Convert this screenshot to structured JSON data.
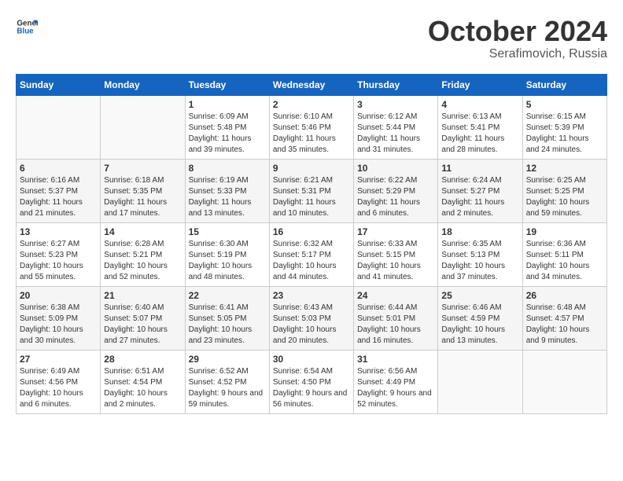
{
  "header": {
    "logo_general": "General",
    "logo_blue": "Blue",
    "title": "October 2024",
    "subtitle": "Serafimovich, Russia"
  },
  "days_of_week": [
    "Sunday",
    "Monday",
    "Tuesday",
    "Wednesday",
    "Thursday",
    "Friday",
    "Saturday"
  ],
  "weeks": [
    [
      {
        "day": "",
        "content": ""
      },
      {
        "day": "",
        "content": ""
      },
      {
        "day": "1",
        "content": "Sunrise: 6:09 AM\nSunset: 5:48 PM\nDaylight: 11 hours and 39 minutes."
      },
      {
        "day": "2",
        "content": "Sunrise: 6:10 AM\nSunset: 5:46 PM\nDaylight: 11 hours and 35 minutes."
      },
      {
        "day": "3",
        "content": "Sunrise: 6:12 AM\nSunset: 5:44 PM\nDaylight: 11 hours and 31 minutes."
      },
      {
        "day": "4",
        "content": "Sunrise: 6:13 AM\nSunset: 5:41 PM\nDaylight: 11 hours and 28 minutes."
      },
      {
        "day": "5",
        "content": "Sunrise: 6:15 AM\nSunset: 5:39 PM\nDaylight: 11 hours and 24 minutes."
      }
    ],
    [
      {
        "day": "6",
        "content": "Sunrise: 6:16 AM\nSunset: 5:37 PM\nDaylight: 11 hours and 21 minutes."
      },
      {
        "day": "7",
        "content": "Sunrise: 6:18 AM\nSunset: 5:35 PM\nDaylight: 11 hours and 17 minutes."
      },
      {
        "day": "8",
        "content": "Sunrise: 6:19 AM\nSunset: 5:33 PM\nDaylight: 11 hours and 13 minutes."
      },
      {
        "day": "9",
        "content": "Sunrise: 6:21 AM\nSunset: 5:31 PM\nDaylight: 11 hours and 10 minutes."
      },
      {
        "day": "10",
        "content": "Sunrise: 6:22 AM\nSunset: 5:29 PM\nDaylight: 11 hours and 6 minutes."
      },
      {
        "day": "11",
        "content": "Sunrise: 6:24 AM\nSunset: 5:27 PM\nDaylight: 11 hours and 2 minutes."
      },
      {
        "day": "12",
        "content": "Sunrise: 6:25 AM\nSunset: 5:25 PM\nDaylight: 10 hours and 59 minutes."
      }
    ],
    [
      {
        "day": "13",
        "content": "Sunrise: 6:27 AM\nSunset: 5:23 PM\nDaylight: 10 hours and 55 minutes."
      },
      {
        "day": "14",
        "content": "Sunrise: 6:28 AM\nSunset: 5:21 PM\nDaylight: 10 hours and 52 minutes."
      },
      {
        "day": "15",
        "content": "Sunrise: 6:30 AM\nSunset: 5:19 PM\nDaylight: 10 hours and 48 minutes."
      },
      {
        "day": "16",
        "content": "Sunrise: 6:32 AM\nSunset: 5:17 PM\nDaylight: 10 hours and 44 minutes."
      },
      {
        "day": "17",
        "content": "Sunrise: 6:33 AM\nSunset: 5:15 PM\nDaylight: 10 hours and 41 minutes."
      },
      {
        "day": "18",
        "content": "Sunrise: 6:35 AM\nSunset: 5:13 PM\nDaylight: 10 hours and 37 minutes."
      },
      {
        "day": "19",
        "content": "Sunrise: 6:36 AM\nSunset: 5:11 PM\nDaylight: 10 hours and 34 minutes."
      }
    ],
    [
      {
        "day": "20",
        "content": "Sunrise: 6:38 AM\nSunset: 5:09 PM\nDaylight: 10 hours and 30 minutes."
      },
      {
        "day": "21",
        "content": "Sunrise: 6:40 AM\nSunset: 5:07 PM\nDaylight: 10 hours and 27 minutes."
      },
      {
        "day": "22",
        "content": "Sunrise: 6:41 AM\nSunset: 5:05 PM\nDaylight: 10 hours and 23 minutes."
      },
      {
        "day": "23",
        "content": "Sunrise: 6:43 AM\nSunset: 5:03 PM\nDaylight: 10 hours and 20 minutes."
      },
      {
        "day": "24",
        "content": "Sunrise: 6:44 AM\nSunset: 5:01 PM\nDaylight: 10 hours and 16 minutes."
      },
      {
        "day": "25",
        "content": "Sunrise: 6:46 AM\nSunset: 4:59 PM\nDaylight: 10 hours and 13 minutes."
      },
      {
        "day": "26",
        "content": "Sunrise: 6:48 AM\nSunset: 4:57 PM\nDaylight: 10 hours and 9 minutes."
      }
    ],
    [
      {
        "day": "27",
        "content": "Sunrise: 6:49 AM\nSunset: 4:56 PM\nDaylight: 10 hours and 6 minutes."
      },
      {
        "day": "28",
        "content": "Sunrise: 6:51 AM\nSunset: 4:54 PM\nDaylight: 10 hours and 2 minutes."
      },
      {
        "day": "29",
        "content": "Sunrise: 6:52 AM\nSunset: 4:52 PM\nDaylight: 9 hours and 59 minutes."
      },
      {
        "day": "30",
        "content": "Sunrise: 6:54 AM\nSunset: 4:50 PM\nDaylight: 9 hours and 56 minutes."
      },
      {
        "day": "31",
        "content": "Sunrise: 6:56 AM\nSunset: 4:49 PM\nDaylight: 9 hours and 52 minutes."
      },
      {
        "day": "",
        "content": ""
      },
      {
        "day": "",
        "content": ""
      }
    ]
  ]
}
